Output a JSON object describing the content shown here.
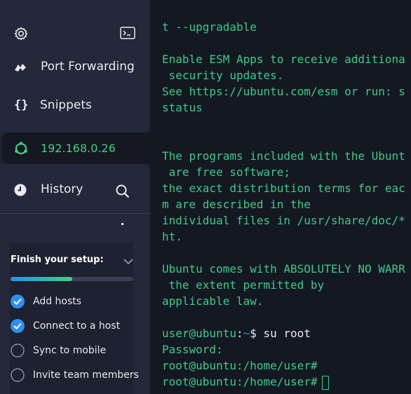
{
  "colors": {
    "sidebar_bg": "#24283a",
    "selected_bg": "#151722",
    "terminal_bg": "#141823",
    "terminal_text": "#41c987",
    "accent_blue": "#2f8ef0",
    "accent_green": "#3fd07f"
  },
  "sidebar": {
    "top_icons": [
      "gear-icon",
      "terminal-icon"
    ],
    "items": [
      {
        "label": "Port Forwarding",
        "icon": "port-forwarding-icon"
      },
      {
        "label": "Snippets",
        "icon": "snippets-icon"
      },
      {
        "label": "192.168.0.26",
        "icon": "ubuntu-icon",
        "selected": true
      },
      {
        "label": "History",
        "icon": "history-icon"
      }
    ],
    "search_icon": "search-icon"
  },
  "setup": {
    "title": "Finish your setup:",
    "progress": 0.5,
    "tasks": [
      {
        "label": "Add hosts",
        "done": true
      },
      {
        "label": "Connect to a host",
        "done": true
      },
      {
        "label": "Sync to mobile",
        "done": false
      },
      {
        "label": "Invite team members",
        "done": false
      }
    ]
  },
  "terminal": {
    "lines": [
      "t --upgradable",
      "",
      "Enable ESM Apps to receive additiona",
      " security updates.",
      "See https://ubuntu.com/esm or run: s",
      "status",
      "",
      "",
      "The programs included with the Ubunt",
      " are free software;",
      "the exact distribution terms for eac",
      "m are described in the",
      "individual files in /usr/share/doc/*",
      "ht.",
      "",
      "Ubuntu comes with ABSOLUTELY NO WARR",
      " the extent permitted by",
      "applicable law.",
      ""
    ],
    "prompt_user": "user@ubuntu",
    "prompt_sep": ":",
    "prompt_path": "~",
    "prompt_symbol": "$ ",
    "command": "su root",
    "password_line": "Password:",
    "root_line_1": "root@ubuntu:/home/user#",
    "root_line_2": "root@ubuntu:/home/user#"
  }
}
